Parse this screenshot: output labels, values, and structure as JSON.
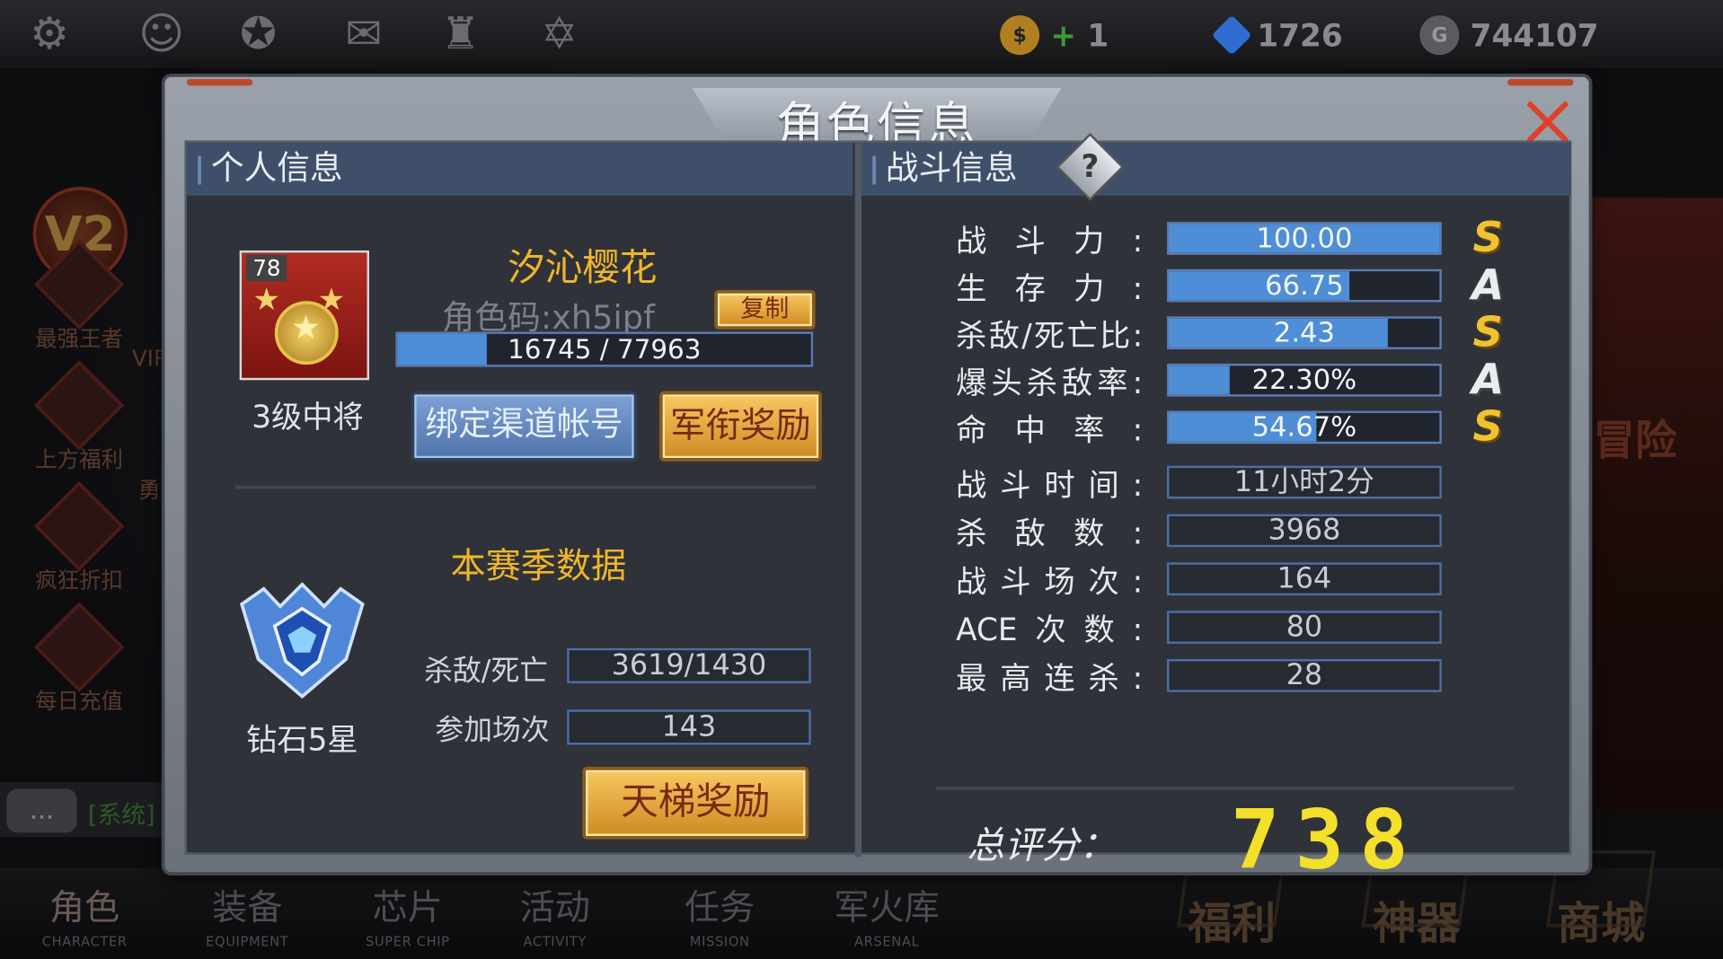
{
  "topbar": {
    "icons": [
      "gear-icon",
      "friends-icon",
      "wings-icon",
      "mail-icon",
      "trophy-icon",
      "star-of-david-icon"
    ],
    "currency": [
      {
        "icon": "gold-coin-icon",
        "value": "1",
        "color": "#d8a020"
      },
      {
        "icon": "diamond-icon",
        "value": "1726",
        "color": "#3a7fd6"
      },
      {
        "icon": "gp-coin-icon",
        "value": "744107",
        "color": "#8a8a90"
      }
    ]
  },
  "side_menu": {
    "badge": "V2",
    "items": [
      "最强王者",
      "VIP特",
      "上方福利",
      "勇者",
      "疯狂折扣",
      "每日充值"
    ]
  },
  "chat": {
    "bubble": "…",
    "text": "[系统]"
  },
  "right_art": {
    "text": "冒险"
  },
  "bottom_nav": {
    "tabs": [
      {
        "zh": "角色",
        "en": "CHARACTER"
      },
      {
        "zh": "装备",
        "en": "EQUIPMENT"
      },
      {
        "zh": "芯片",
        "en": "SUPER CHIP"
      },
      {
        "zh": "活动",
        "en": "ACTIVITY"
      },
      {
        "zh": "任务",
        "en": "MISSION"
      },
      {
        "zh": "军火库",
        "en": "ARSENAL"
      }
    ],
    "big": [
      "福利",
      "神器",
      "商城"
    ]
  },
  "dialog": {
    "title": "角色信息",
    "personal": {
      "header": "个人信息",
      "level": "78",
      "rank_name": "3级中将",
      "player_name": "汐沁樱花",
      "role_code": "角色码:xh5ipf",
      "copy_button": "复制",
      "xp_current": 16745,
      "xp_max": 77963,
      "xp_text": "16745 / 77963",
      "bind_button": "绑定渠道帐号",
      "rank_reward_button": "军衔奖励",
      "season_title": "本赛季数据",
      "tier_name": "钻石5星",
      "kd_label": "杀敌/死亡",
      "kd_value": "3619/1430",
      "matches_label": "参加场次",
      "matches_value": "143",
      "ladder_button": "天梯奖励"
    },
    "battle": {
      "header": "战斗信息",
      "help": "?",
      "bar_stats": [
        {
          "label": "战斗力:",
          "value": "100.00",
          "fill": 1.0,
          "grade": "S"
        },
        {
          "label": "生存力:",
          "value": "66.75",
          "fill": 0.6675,
          "grade": "A"
        },
        {
          "label": "杀敌/死亡比:",
          "value": "2.43",
          "fill": 0.81,
          "grade": "S"
        },
        {
          "label": "爆头杀敌率:",
          "value": "22.30%",
          "fill": 0.223,
          "grade": "A"
        },
        {
          "label": "命中率:",
          "value": "54.67%",
          "fill": 0.5467,
          "grade": "S"
        }
      ],
      "box_stats": [
        {
          "label": "战斗时间:",
          "value": "11小时2分"
        },
        {
          "label": "杀敌数:",
          "value": "3968"
        },
        {
          "label": "战斗场次:",
          "value": "164"
        },
        {
          "label": "ACE次数:",
          "value": "80"
        },
        {
          "label": "最高连杀:",
          "value": "28"
        }
      ],
      "total_label": "总评分：",
      "total_score": "738"
    }
  }
}
